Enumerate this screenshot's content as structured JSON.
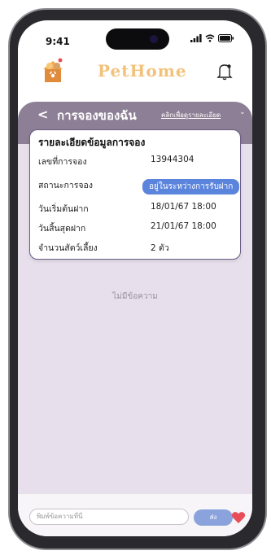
{
  "status": {
    "time": "9:41"
  },
  "app": {
    "brand_name": "PetHome"
  },
  "header": {
    "back": "<",
    "title": "การจองของฉัน",
    "detail_link": "คลิกเพื่อดูรายละเอียด",
    "detail_chevron": "⌄"
  },
  "card": {
    "title": "รายละเอียดข้อมูลการจอง",
    "rows": [
      {
        "label": "เลขที่การจอง",
        "value": "13944304"
      },
      {
        "label": "สถานะการจอง",
        "value": "อยู่ในระหว่างการรับฝาก"
      },
      {
        "label": "วันเริ่มต้นฝาก",
        "value": "18/01/67 18:00"
      },
      {
        "label": "วันสิ้นสุดฝาก",
        "value": "21/01/67 18:00"
      },
      {
        "label": "จำนวนสัตว์เลี้ยง",
        "value": "2 ตัว"
      }
    ]
  },
  "chat": {
    "empty_text": "ไม่มีข้อความ",
    "input_placeholder": "พิมพ์ข้อความที่นี่",
    "send_label": "ส่ง"
  },
  "colors": {
    "brand": "#f2c27b",
    "header_band": "#8d7f95",
    "content_bg": "#e7e0ec",
    "status_badge": "#5b84dc",
    "send_button": "#8aa3dc",
    "heart": "#e74c57"
  },
  "icons": [
    "signal-icon",
    "wifi-icon",
    "battery-icon",
    "pethome-logo-icon",
    "notification-bell-icon",
    "back-chevron-icon",
    "heart-icon"
  ]
}
